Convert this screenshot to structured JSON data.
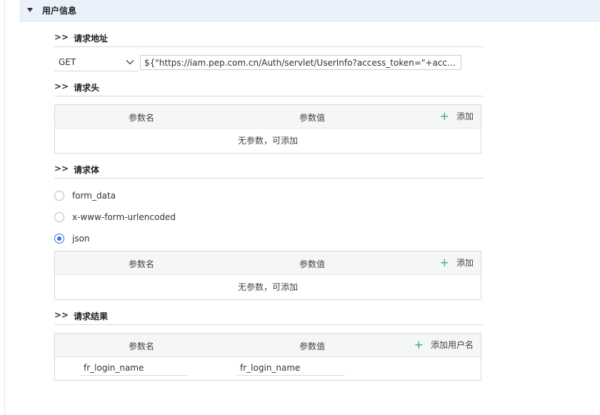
{
  "section": {
    "title": "用户信息"
  },
  "request_url": {
    "heading_marker": ">>",
    "heading": "请求地址",
    "method": "GET",
    "url": "${\"https://iam.pep.com.cn/Auth/servlet/UserInfo?access_token=\"+access_t..."
  },
  "request_headers": {
    "heading_marker": ">>",
    "heading": "请求头",
    "col_name": "参数名",
    "col_value": "参数值",
    "add_label": "添加",
    "empty_text": "无参数，可添加"
  },
  "request_body": {
    "heading_marker": ">>",
    "heading": "请求体",
    "options": [
      "form_data",
      "x-www-form-urlencoded",
      "json"
    ],
    "selected": "json",
    "col_name": "参数名",
    "col_value": "参数值",
    "add_label": "添加",
    "empty_text": "无参数，可添加"
  },
  "request_result": {
    "heading_marker": ">>",
    "heading": "请求结果",
    "col_name": "参数名",
    "col_value": "参数值",
    "add_label": "添加用户名",
    "rows": [
      {
        "name": "fr_login_name",
        "value": "fr_login_name"
      }
    ]
  },
  "colors": {
    "header_bg": "#eaf1fb",
    "accent": "#3a6fd8",
    "add_icon": "#2fb466"
  }
}
